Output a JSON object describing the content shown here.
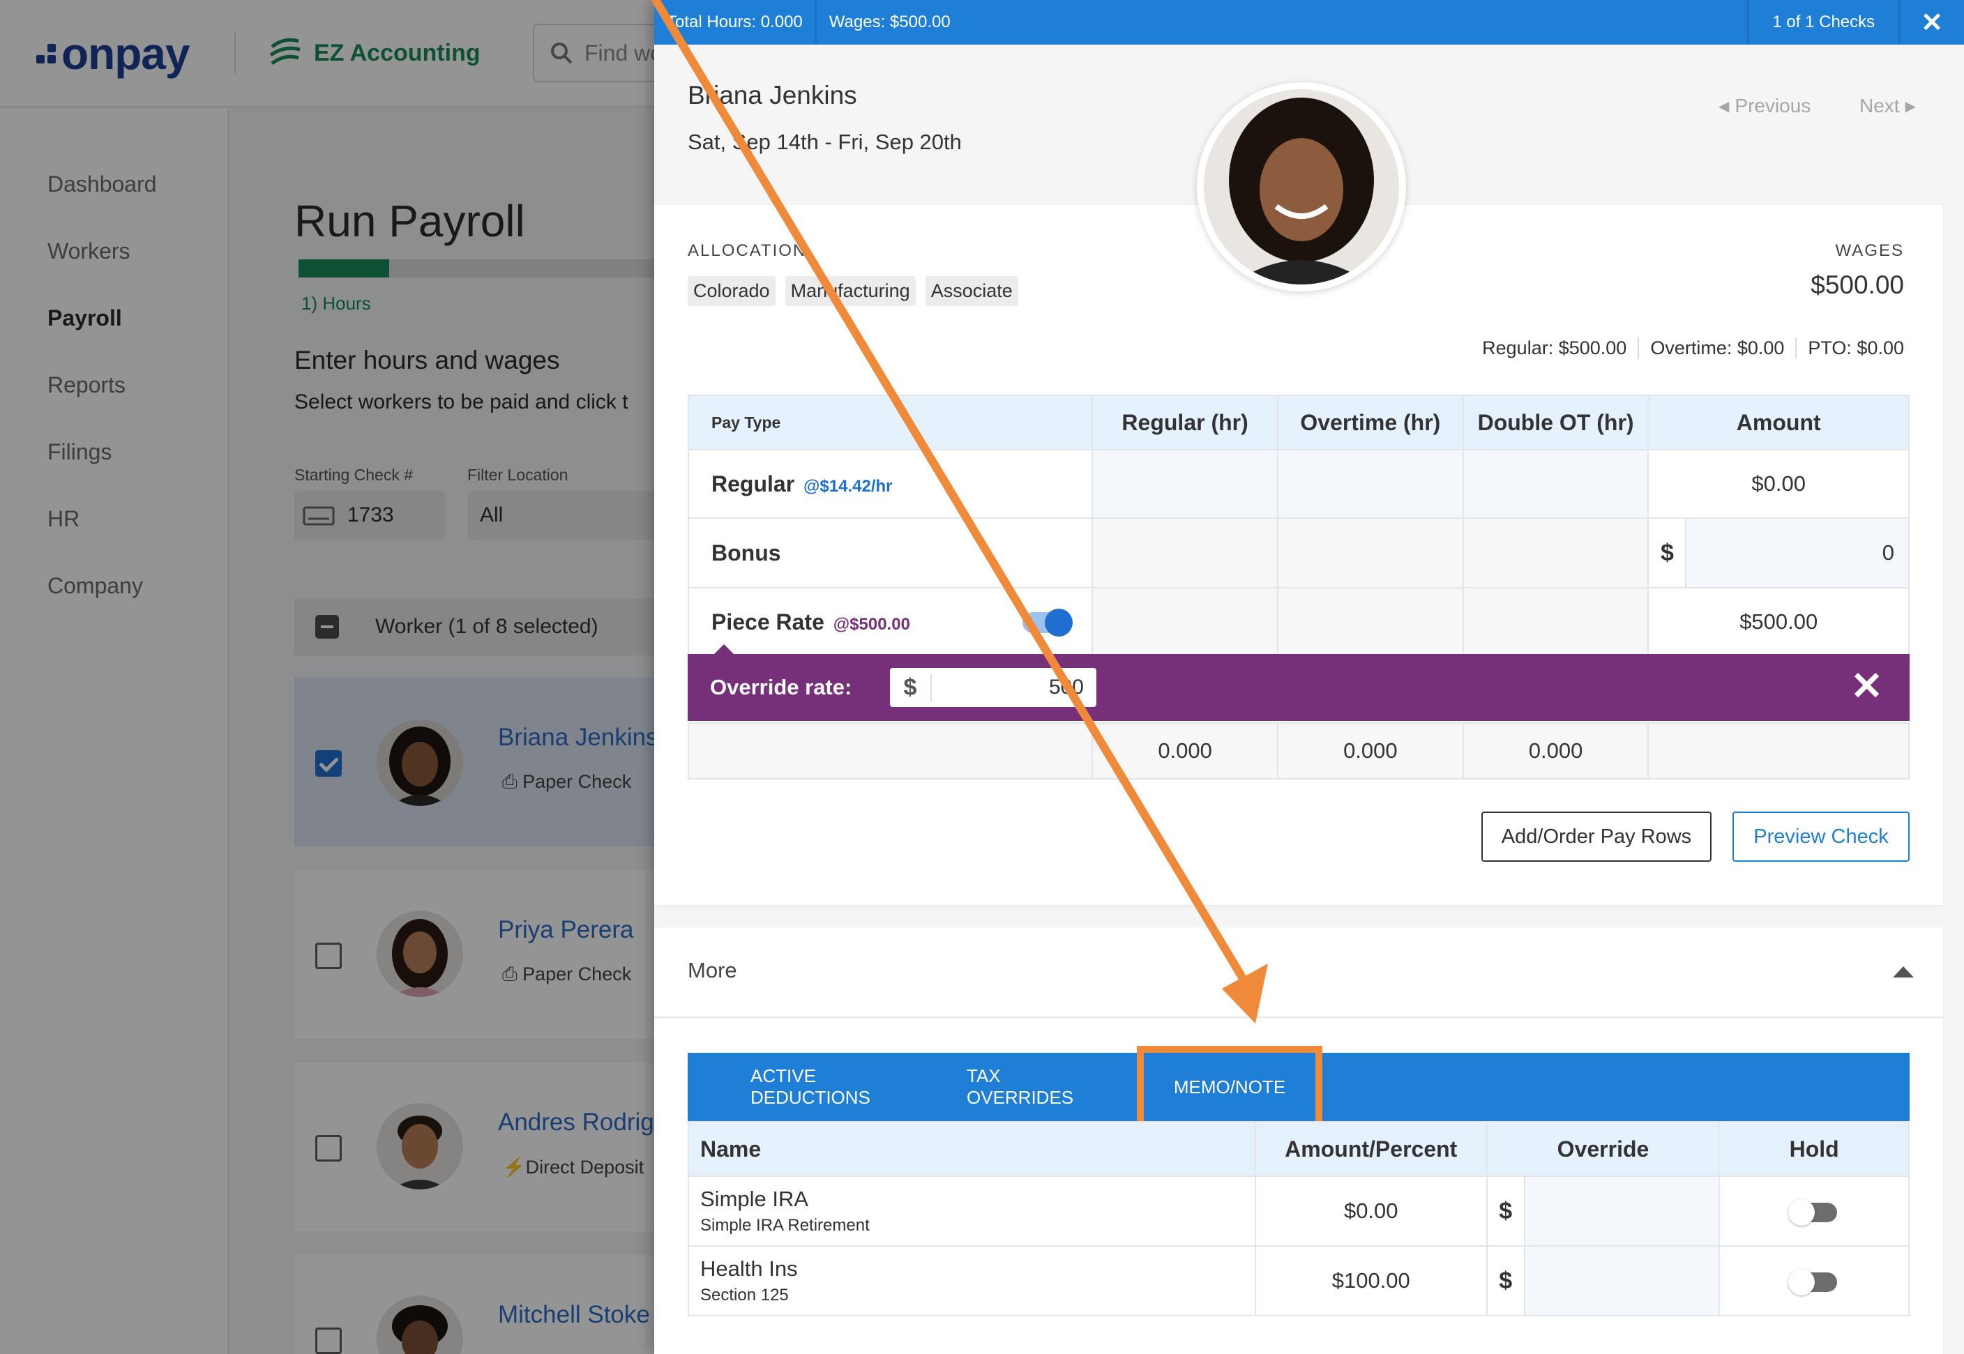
{
  "app": {
    "brand": "onpay",
    "partner": "EZ Accounting",
    "search_placeholder": "Find wo"
  },
  "sidebar": {
    "items": [
      {
        "label": "Dashboard"
      },
      {
        "label": "Workers"
      },
      {
        "label": "Payroll",
        "active": true
      },
      {
        "label": "Reports"
      },
      {
        "label": "Filings"
      },
      {
        "label": "HR"
      },
      {
        "label": "Company"
      }
    ]
  },
  "page": {
    "title": "Run Payroll",
    "step_label": "1) Hours",
    "step_progress": 0.25,
    "section_title": "Enter hours and wages",
    "section_sub": "Select workers to be paid and click t",
    "starting_check_label": "Starting Check #",
    "starting_check_value": "1733",
    "filter_location_label": "Filter Location",
    "filter_location_value": "All",
    "worker_header": "Worker (1 of 8 selected)",
    "workers": [
      {
        "name": "Briana Jenkins",
        "pay_method": "Paper Check",
        "pay_icon": "printer-icon",
        "selected": true
      },
      {
        "name": "Priya Perera",
        "pay_method": "Paper Check",
        "pay_icon": "printer-icon",
        "selected": false
      },
      {
        "name": "Andres Rodrig",
        "pay_method": "Direct Deposit",
        "pay_icon": "bolt-icon",
        "selected": false
      },
      {
        "name": "Mitchell Stoke",
        "pay_method": "",
        "pay_icon": "",
        "selected": false
      }
    ]
  },
  "panel": {
    "top_bar": {
      "total_hours": "Total Hours: 0.000",
      "wages": "Wages: $500.00",
      "checks": "1 of 1 Checks",
      "close": "✕"
    },
    "employee_name": "Briana Jenkins",
    "date_range": "Sat, Sep 14th - Fri, Sep 20th",
    "previous_label": "Previous",
    "next_label": "Next",
    "allocation_label": "ALLOCATION",
    "allocation_chips": [
      "Colorado",
      "Manufacturing",
      "Associate"
    ],
    "wages_label": "WAGES",
    "wages_total": "$500.00",
    "breakdown": [
      "Regular: $500.00",
      "Overtime: $0.00",
      "PTO: $0.00"
    ],
    "pay_table": {
      "headers": [
        "Pay Type",
        "Regular (hr)",
        "Overtime (hr)",
        "Double OT (hr)",
        "Amount"
      ],
      "rows": [
        {
          "label": "Regular",
          "rate": "@$14.42/hr",
          "amount": "$0.00"
        },
        {
          "label": "Bonus",
          "currency": "$",
          "amount_input": "0"
        },
        {
          "label": "Piece Rate",
          "rate": "@$500.00",
          "toggle_on": true,
          "amount": "$500.00"
        }
      ],
      "totals": [
        "0.000",
        "0.000",
        "0.000"
      ]
    },
    "override": {
      "label": "Override rate:",
      "currency": "$",
      "value": "500",
      "close": "✕"
    },
    "buttons": {
      "add_order": "Add/Order Pay Rows",
      "preview": "Preview Check"
    },
    "more": {
      "title": "More",
      "tabs": [
        "ACTIVE DEDUCTIONS",
        "TAX OVERRIDES",
        "MEMO/NOTE"
      ],
      "highlighted_tab": "MEMO/NOTE",
      "table": {
        "headers": [
          "Name",
          "Amount/Percent",
          "Override",
          "Hold"
        ],
        "rows": [
          {
            "name": "Simple IRA",
            "sub": "Simple IRA Retirement",
            "amount": "$0.00",
            "currency": "$",
            "hold": false
          },
          {
            "name": "Health Ins",
            "sub": "Section 125",
            "amount": "$100.00",
            "currency": "$",
            "hold": false
          }
        ]
      }
    }
  },
  "colors": {
    "brand_blue": "#1c3f95",
    "accent_blue": "#1f7ed6",
    "green": "#178a5b",
    "purple": "#76307a",
    "annotation_orange": "#ef8a3b"
  }
}
